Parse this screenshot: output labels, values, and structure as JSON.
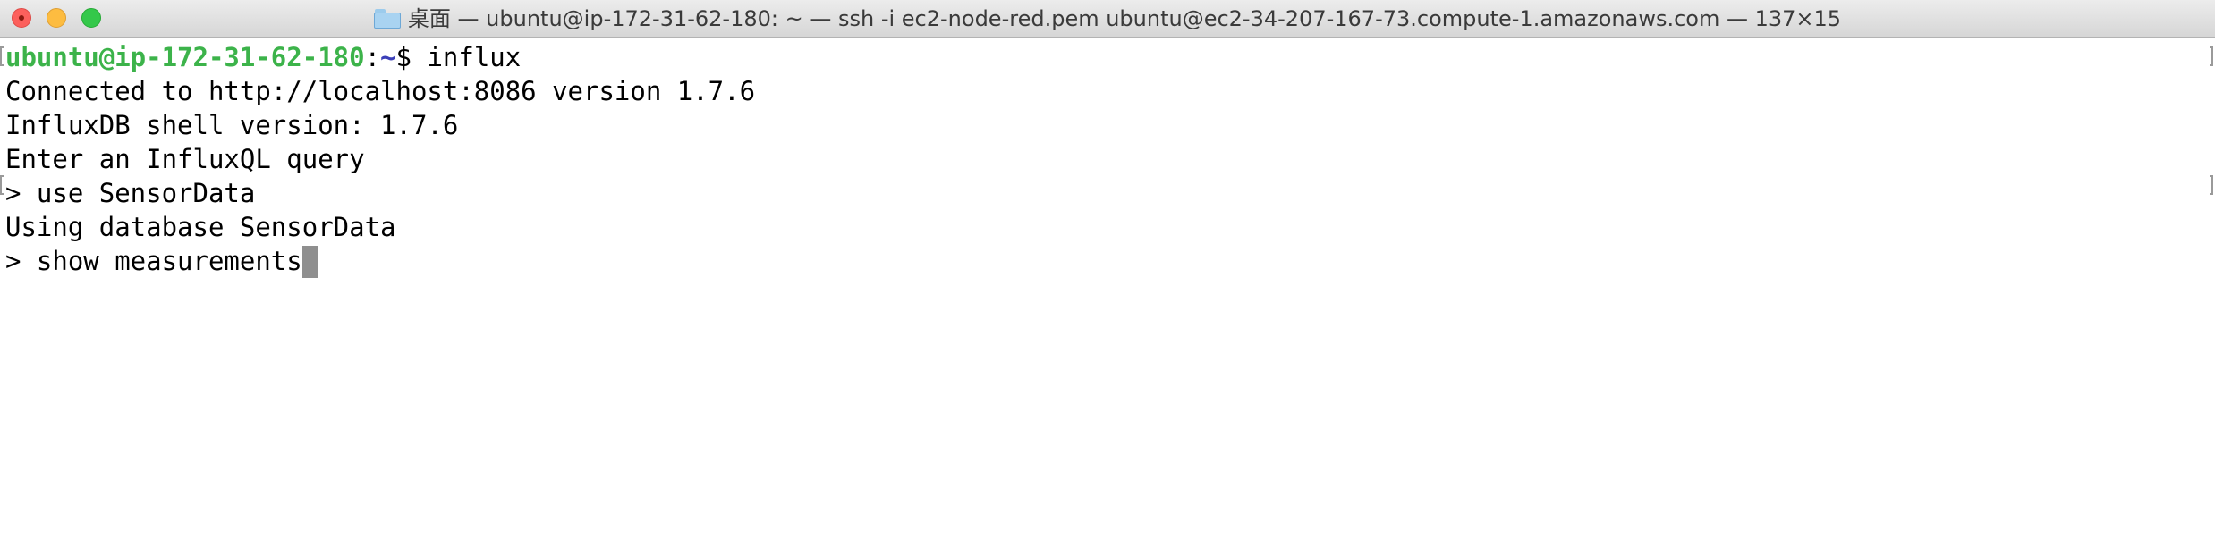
{
  "window": {
    "title": "桌面 — ubuntu@ip-172-31-62-180: ~ — ssh -i ec2-node-red.pem ubuntu@ec2-34-207-167-73.compute-1.amazonaws.com — 137×15",
    "folder_icon": "folder-icon"
  },
  "terminal": {
    "prompt": {
      "user_host": "ubuntu@ip-172-31-62-180",
      "colon": ":",
      "path": "~",
      "symbol": "$ ",
      "command": "influx"
    },
    "output_lines": [
      "Connected to http://localhost:8086 version 1.7.6",
      "InfluxDB shell version: 1.7.6",
      "Enter an InfluxQL query"
    ],
    "query1": "> use SensorData",
    "response1": "Using database SensorData",
    "query2": "> show measurements"
  },
  "colors": {
    "prompt_user_host": "#3cb34a",
    "prompt_path": "#3b3fb8",
    "close": "#fc605c",
    "minimize": "#fdbc40",
    "zoom": "#34c84a"
  }
}
